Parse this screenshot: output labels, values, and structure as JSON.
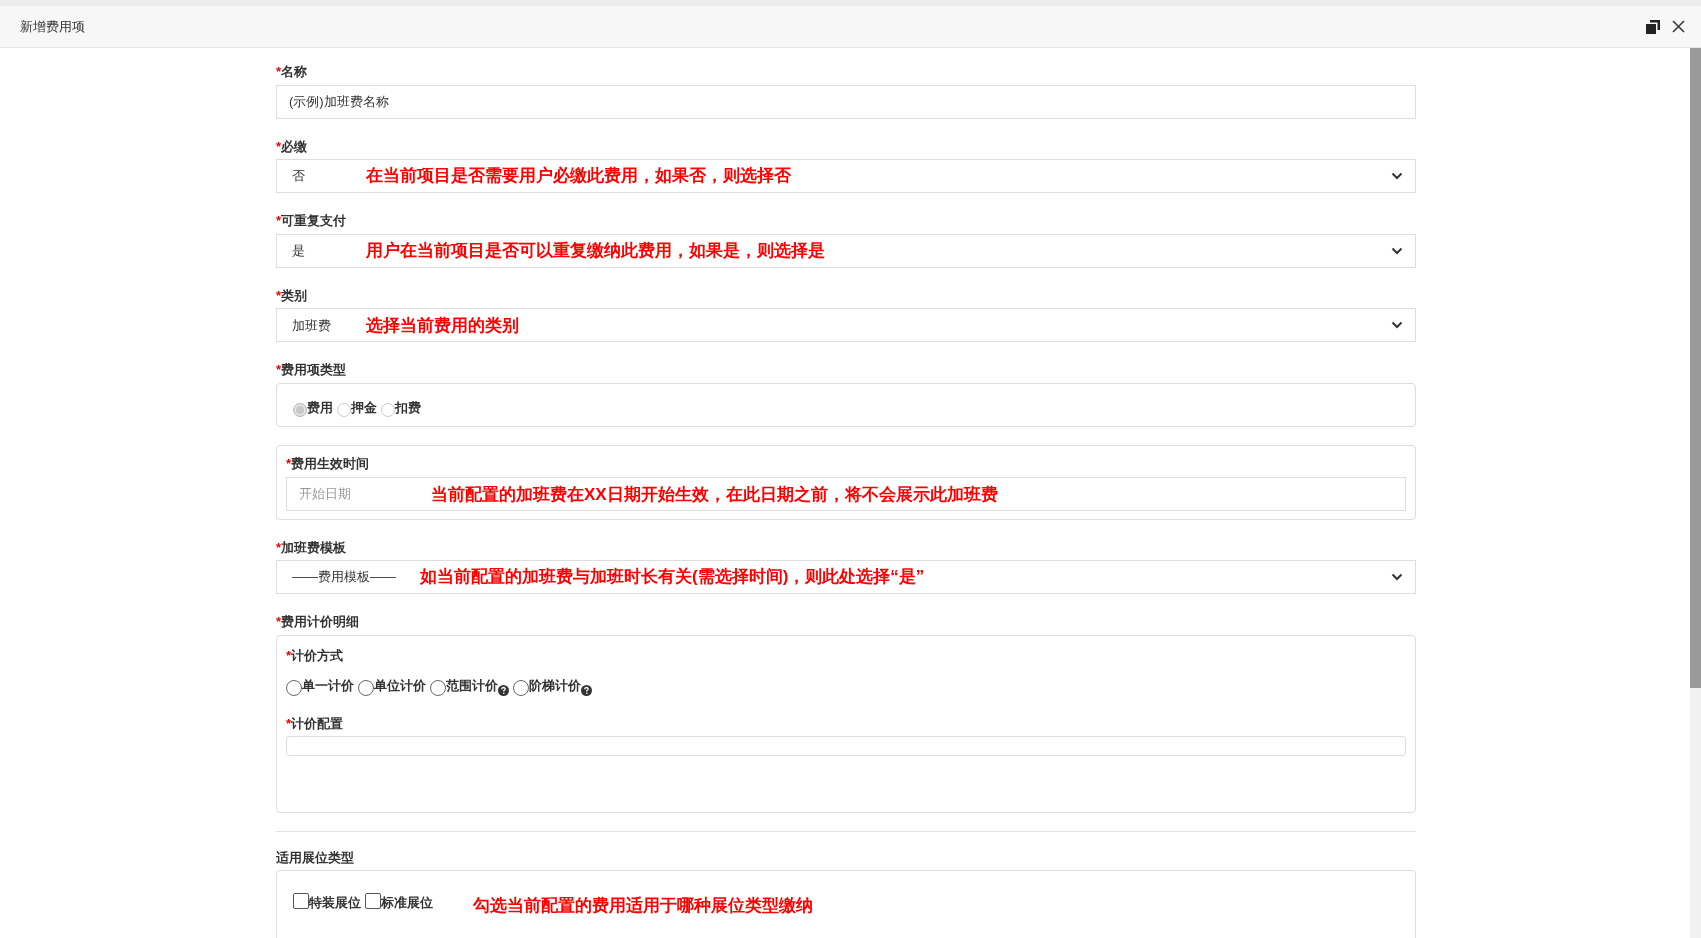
{
  "dialog": {
    "title": "新增费用项"
  },
  "fields": [
    {
      "kind": "text",
      "required_mark": "*",
      "label": "名称",
      "value": "(示例)加班费名称"
    },
    {
      "kind": "select",
      "required_mark": "*",
      "label": "必缴",
      "value": "否",
      "annotation": "在当前项目是否需要用户必缴此费用，如果否，则选择否"
    },
    {
      "kind": "select",
      "required_mark": "*",
      "label": "可重复支付",
      "value": "是",
      "annotation": "用户在当前项目是否可以重复缴纳此费用，如果是，则选择是"
    },
    {
      "kind": "select",
      "required_mark": "*",
      "label": "类别",
      "value": "加班费",
      "annotation": "选择当前费用的类别"
    },
    {
      "kind": "radios",
      "required_mark": "*",
      "label": "费用项类型",
      "disabled": true,
      "options": [
        {
          "label": "费用",
          "selected": true
        },
        {
          "label": "押金",
          "selected": false
        },
        {
          "label": "扣费",
          "selected": false
        }
      ]
    },
    {
      "kind": "date",
      "required_mark": "*",
      "label": "费用生效时间",
      "placeholder": "开始日期",
      "annotation": "当前配置的加班费在XX日期开始生效，在此日期之前，将不会展示此加班费"
    },
    {
      "kind": "select",
      "required_mark": "*",
      "label": "加班费模板",
      "value": "——费用模板——",
      "annotation": "如当前配置的加班费与加班时长有关(需选择时间)，则此处选择“是”"
    },
    {
      "kind": "pricing",
      "required_mark": "*",
      "label": "费用计价明细",
      "method": {
        "required_mark": "*",
        "label": "计价方式",
        "options": [
          {
            "label": "单一计价",
            "selected": false,
            "help": false
          },
          {
            "label": "单位计价",
            "selected": false,
            "help": false
          },
          {
            "label": "范围计价",
            "selected": false,
            "help": true
          },
          {
            "label": "阶梯计价",
            "selected": false,
            "help": true
          }
        ]
      },
      "config": {
        "required_mark": "*",
        "label": "计价配置"
      }
    },
    {
      "kind": "divider"
    },
    {
      "kind": "checks",
      "label": "适用展位类型",
      "options": [
        {
          "label": "特装展位",
          "checked": false
        },
        {
          "label": "标准展位",
          "checked": false
        }
      ],
      "annotation": "勾选当前配置的费用适用于哪种展位类型缴纳"
    }
  ]
}
